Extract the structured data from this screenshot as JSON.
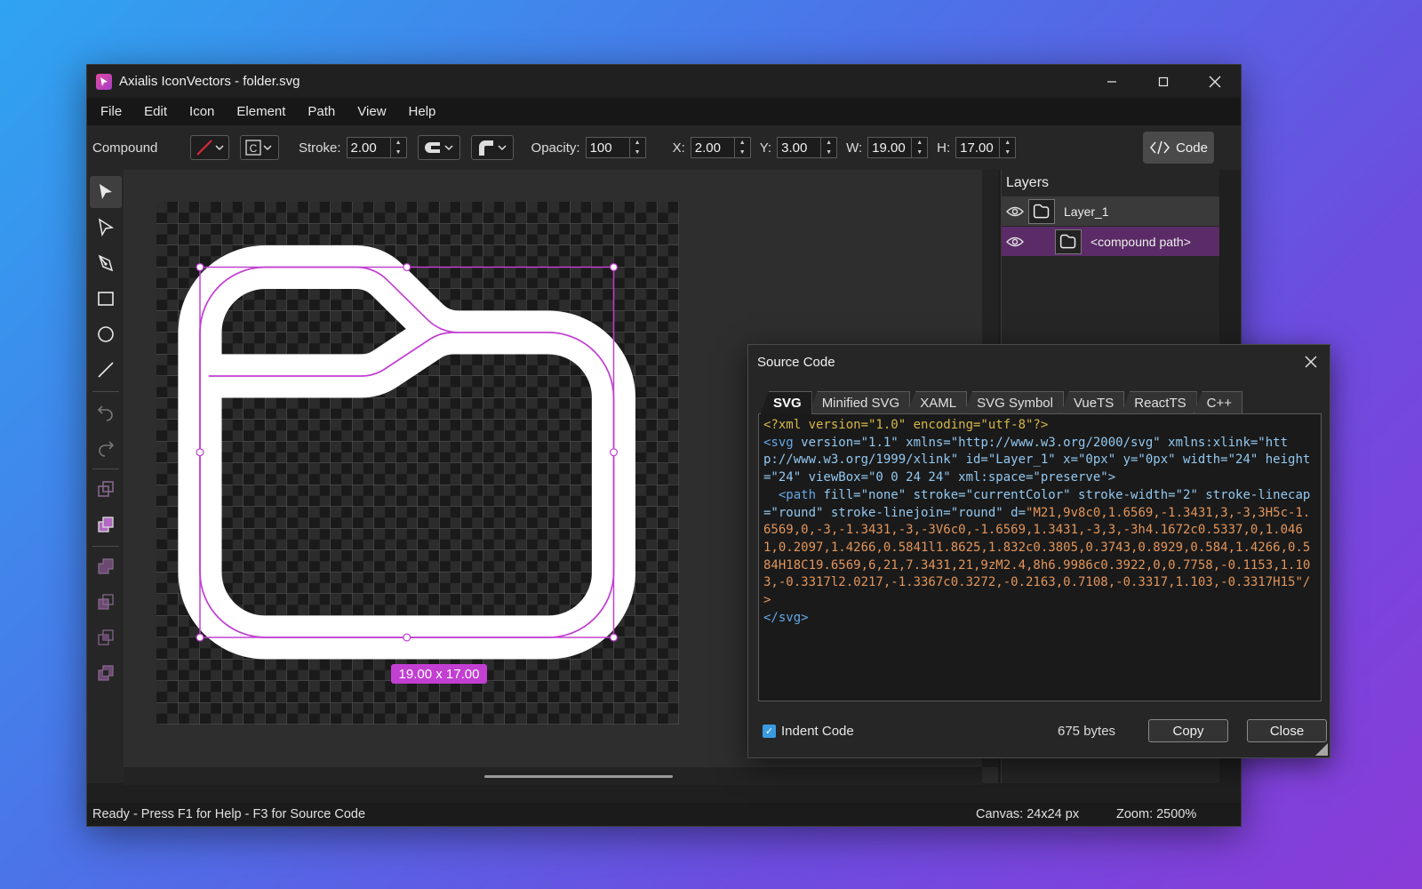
{
  "window": {
    "title": "Axialis IconVectors - folder.svg",
    "minimize": "─",
    "maximize": "☐",
    "close": "✕"
  },
  "menu": [
    "File",
    "Edit",
    "Icon",
    "Element",
    "Path",
    "View",
    "Help"
  ],
  "toolbar": {
    "object_type": "Compound",
    "stroke_label": "Stroke:",
    "stroke_value": "2.00",
    "opacity_label": "Opacity:",
    "opacity_value": "100",
    "x_label": "X:",
    "x_value": "2.00",
    "y_label": "Y:",
    "y_value": "3.00",
    "w_label": "W:",
    "w_value": "19.00",
    "h_label": "H:",
    "h_value": "17.00",
    "code_label": "Code",
    "accent_color": "#c23fd2"
  },
  "canvas": {
    "selection_size": "19.00 x 17.00"
  },
  "layers": {
    "title": "Layers",
    "items": [
      {
        "name": "Layer_1",
        "selected": false
      },
      {
        "name": "<compound path>",
        "selected": true
      }
    ]
  },
  "status": {
    "text": "Ready - Press F1 for Help - F3 for Source Code",
    "canvas": "Canvas: 24x24 px",
    "zoom": "Zoom: 2500%"
  },
  "dialog": {
    "title": "Source Code",
    "tabs": [
      "SVG",
      "Minified SVG",
      "XAML",
      "SVG Symbol",
      "VueTS",
      "ReactTS",
      "C++"
    ],
    "active_tab": "SVG",
    "code": {
      "l1_pi": "<?xml version=\"1.0\" encoding=\"utf-8\"?>",
      "svg_open": "<svg ",
      "svg_attrs": "version=\"1.1\" xmlns=\"http://www.w3.org/2000/svg\" xmlns:xlink=\"http://www.w3.org/1999/xlink\" id=\"Layer_1\" x=\"0px\" y=\"0px\" width=\"24\" height=\"24\" viewBox=\"0 0 24 24\" xml:space=\"preserve\">",
      "path_open": "  <path ",
      "path_attrs": "fill=\"none\" stroke=\"currentColor\" stroke-width=\"2\" stroke-linecap=\"round\" stroke-linejoin=\"round\" d=",
      "path_d": "\"M21,9v8c0,1.6569,-1.3431,3,-3,3H5c-1.6569,0,-3,-1.3431,-3,-3V6c0,-1.6569,1.3431,-3,3,-3h4.1672c0.5337,0,1.0461,0.2097,1.4266,0.5841l1.8625,1.832c0.3805,0.3743,0.8929,0.584,1.4266,0.584H18C19.6569,6,21,7.3431,21,9zM2.4,8h6.9986c0.3922,0,0.7758,-0.1153,1.103,-0.3317l2.0217,-1.3367c0.3272,-0.2163,0.7108,-0.3317,1.103,-0.3317H15\"/>",
      "svg_close": "</svg>"
    },
    "indent_label": "Indent Code",
    "indent_checked": true,
    "size": "675 bytes",
    "copy_label": "Copy",
    "close_label": "Close"
  }
}
